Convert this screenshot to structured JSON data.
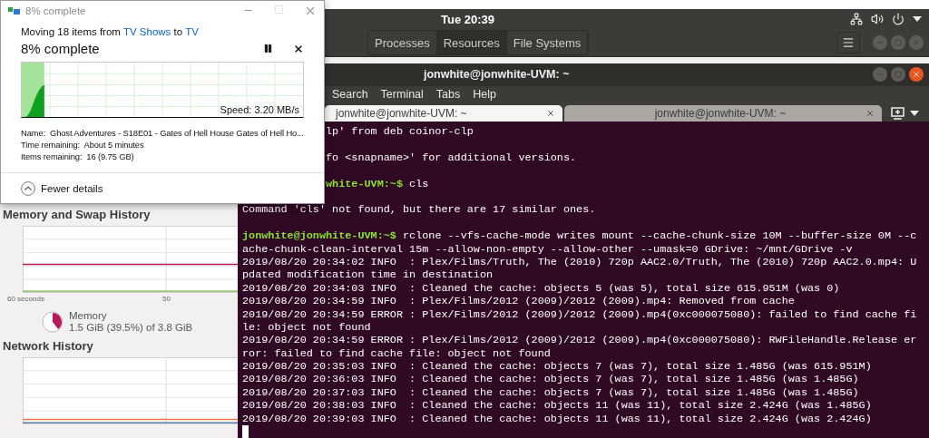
{
  "top_panel": {
    "clock": "Tue 20:39"
  },
  "system_monitor": {
    "tabs": [
      {
        "label": "Processes",
        "selected": false
      },
      {
        "label": "Resources",
        "selected": true
      },
      {
        "label": "File Systems",
        "selected": false
      }
    ],
    "memory_history": {
      "title": "Memory and Swap History",
      "x_labels": [
        "60 seconds",
        "50"
      ]
    },
    "memory": {
      "label": "Memory",
      "value": "1.5 GiB (39.5%) of 3.8 GiB",
      "level": 0.395
    },
    "network_history": {
      "title": "Network History"
    }
  },
  "terminal": {
    "title": "jonwhite@jonwhite-UVM: ~",
    "menu": [
      "Search",
      "Terminal",
      "Tabs",
      "Help"
    ],
    "tabs": [
      {
        "label": "jonwhite@jonwhite-UVM: ~",
        "selected": true
      },
      {
        "label": "jonwhite@jonwhite-UVM: ~",
        "selected": false
      }
    ],
    "lines": [
      {
        "kind": "output",
        "covered": true,
        "text": "lp' from deb coinor-clp"
      },
      {
        "kind": "blank"
      },
      {
        "kind": "output",
        "covered": true,
        "text": "fo <snapname>' for additional versions."
      },
      {
        "kind": "blank"
      },
      {
        "kind": "prompt",
        "covered": true,
        "prompt": "white-UVM:~$",
        "text": "cls"
      },
      {
        "kind": "blank"
      },
      {
        "kind": "output",
        "covered": false,
        "text": "Command 'cls' not found, but there are 17 similar ones."
      },
      {
        "kind": "blank"
      },
      {
        "kind": "prompt",
        "covered": false,
        "prompt": "jonwhite@jonwhite-UVM:~$",
        "text": "rclone --vfs-cache-mode writes mount --cache-chunk-size 10M --buffer-size 0M --c"
      },
      {
        "kind": "output",
        "covered": false,
        "text": "ache-chunk-clean-interval 15m --allow-non-empty --allow-other --umask=0 GDrive: ~/mnt/GDrive -v"
      },
      {
        "kind": "output",
        "covered": false,
        "text": "2019/08/20 20:34:02 INFO  : Plex/Films/Truth, The (2010) 720p AAC2.0/Truth, The (2010) 720p AAC2.0.mp4: U"
      },
      {
        "kind": "output",
        "covered": false,
        "text": "pdated modification time in destination"
      },
      {
        "kind": "output",
        "covered": false,
        "text": "2019/08/20 20:34:03 INFO  : Cleaned the cache: objects 5 (was 5), total size 615.951M (was 0)"
      },
      {
        "kind": "output",
        "covered": false,
        "text": "2019/08/20 20:34:59 INFO  : Plex/Films/2012 (2009)/2012 (2009).mp4: Removed from cache"
      },
      {
        "kind": "output",
        "covered": false,
        "text": "2019/08/20 20:34:59 ERROR : Plex/Films/2012 (2009)/2012 (2009).mp4(0xc000075080): failed to find cache fi"
      },
      {
        "kind": "output",
        "covered": false,
        "text": "le: object not found"
      },
      {
        "kind": "output",
        "covered": false,
        "text": "2019/08/20 20:34:59 ERROR : Plex/Films/2012 (2009)/2012 (2009).mp4(0xc000075080): RWFileHandle.Release er"
      },
      {
        "kind": "output",
        "covered": false,
        "text": "ror: failed to find cache file: object not found"
      },
      {
        "kind": "output",
        "covered": false,
        "text": "2019/08/20 20:35:03 INFO  : Cleaned the cache: objects 7 (was 7), total size 1.485G (was 615.951M)"
      },
      {
        "kind": "output",
        "covered": false,
        "text": "2019/08/20 20:36:03 INFO  : Cleaned the cache: objects 7 (was 7), total size 1.485G (was 1.485G)"
      },
      {
        "kind": "output",
        "covered": false,
        "text": "2019/08/20 20:37:03 INFO  : Cleaned the cache: objects 7 (was 7), total size 1.485G (was 1.485G)"
      },
      {
        "kind": "output",
        "covered": false,
        "text": "2019/08/20 20:38:03 INFO  : Cleaned the cache: objects 11 (was 11), total size 2.424G (was 1.485G)"
      },
      {
        "kind": "output",
        "covered": false,
        "text": "2019/08/20 20:39:03 INFO  : Cleaned the cache: objects 11 (was 11), total size 2.424G (was 2.424G)"
      }
    ]
  },
  "copy_dialog": {
    "title": "8% complete",
    "message": {
      "prefix": "Moving 18 items from",
      "source": "TV Shows",
      "middle": "to",
      "destination": "TV"
    },
    "heading": "8% complete",
    "level": 0.08,
    "speed": "Speed: 3.20 MB/s",
    "details": [
      "Name:  Ghost Adventures - S18E01 - Gates of Hell House Gates of Hell Ho...",
      "Time remaining:  About 5 minutes",
      "Items remaining:  16 (9.75 GB)"
    ],
    "toggle": "Fewer details"
  }
}
